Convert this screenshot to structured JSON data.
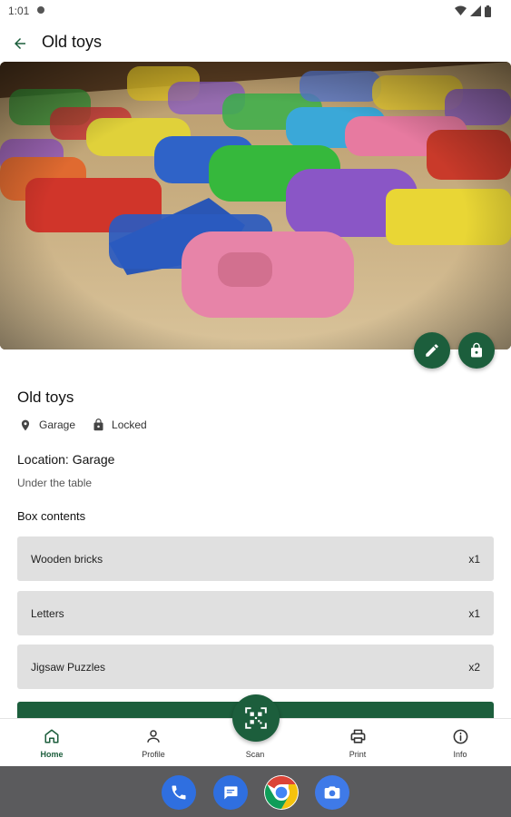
{
  "status_bar": {
    "time": "1:01"
  },
  "app_bar": {
    "title": "Old toys"
  },
  "box": {
    "title": "Old toys",
    "location_tag": "Garage",
    "lock_tag": "Locked",
    "location_heading": "Location: Garage",
    "location_description": "Under the table",
    "contents_heading": "Box contents",
    "items": [
      {
        "name": "Wooden bricks",
        "qty": "x1"
      },
      {
        "name": "Letters",
        "qty": "x1"
      },
      {
        "name": "Jigsaw Puzzles",
        "qty": "x2"
      }
    ]
  },
  "nav": {
    "home": "Home",
    "profile": "Profile",
    "scan": "Scan",
    "print": "Print",
    "info": "Info"
  },
  "colors": {
    "primary": "#1c5e3c",
    "item_bg": "#e0e0e0",
    "dock": "#5b5b5d"
  },
  "icons": [
    "back-arrow-icon",
    "edit-icon",
    "lock-icon",
    "location-pin-icon",
    "home-icon",
    "profile-icon",
    "qr-scan-icon",
    "print-icon",
    "info-icon",
    "phone-icon",
    "messages-icon",
    "chrome-icon",
    "camera-icon"
  ]
}
